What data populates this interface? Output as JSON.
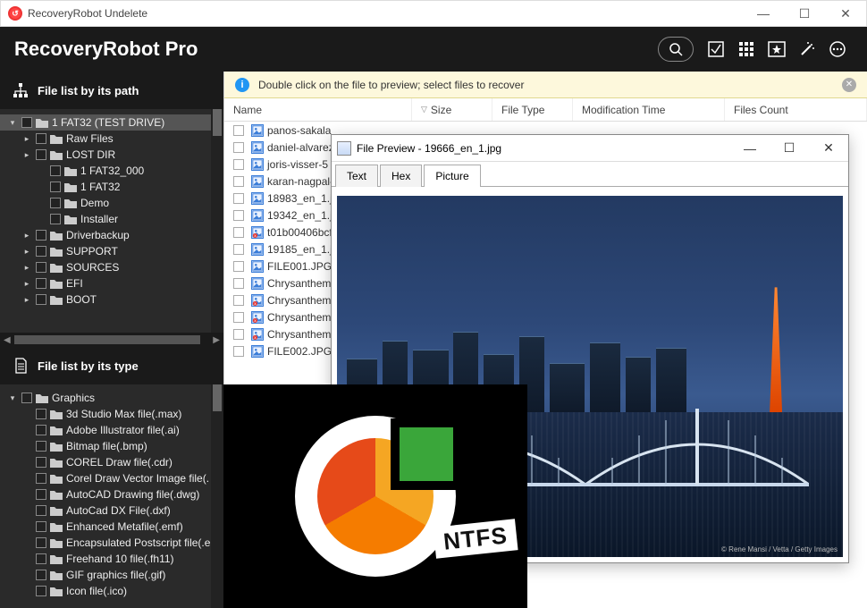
{
  "window": {
    "title": "RecoveryRobot Undelete"
  },
  "brand": "RecoveryRobot Pro",
  "info_bar": {
    "text": "Double click on the file to preview; select files to recover"
  },
  "columns": {
    "name": "Name",
    "size": "Size",
    "file_type": "File Type",
    "mod_time": "Modification Time",
    "files_count": "Files Count"
  },
  "sidebar": {
    "path_header": "File list by its path",
    "type_header": "File list by its type",
    "path_tree": [
      {
        "depth": 0,
        "caret": "▾",
        "label": "1 FAT32 (TEST DRIVE)",
        "selected": true
      },
      {
        "depth": 1,
        "caret": "▸",
        "label": "Raw Files"
      },
      {
        "depth": 1,
        "caret": "▸",
        "label": "LOST DIR"
      },
      {
        "depth": 2,
        "caret": "",
        "label": "1 FAT32_000"
      },
      {
        "depth": 2,
        "caret": "",
        "label": "1 FAT32"
      },
      {
        "depth": 2,
        "caret": "",
        "label": "Demo"
      },
      {
        "depth": 2,
        "caret": "",
        "label": "Installer"
      },
      {
        "depth": 1,
        "caret": "▸",
        "label": "Driverbackup"
      },
      {
        "depth": 1,
        "caret": "▸",
        "label": "SUPPORT"
      },
      {
        "depth": 1,
        "caret": "▸",
        "label": "SOURCES"
      },
      {
        "depth": 1,
        "caret": "▸",
        "label": "EFI"
      },
      {
        "depth": 1,
        "caret": "▸",
        "label": "BOOT"
      }
    ],
    "type_tree": [
      {
        "depth": 0,
        "caret": "▾",
        "label": "Graphics"
      },
      {
        "depth": 1,
        "caret": "",
        "label": "3d Studio Max file(.max)"
      },
      {
        "depth": 1,
        "caret": "",
        "label": "Adobe Illustrator file(.ai)"
      },
      {
        "depth": 1,
        "caret": "",
        "label": "Bitmap file(.bmp)"
      },
      {
        "depth": 1,
        "caret": "",
        "label": "COREL Draw file(.cdr)"
      },
      {
        "depth": 1,
        "caret": "",
        "label": "Corel Draw Vector Image file(."
      },
      {
        "depth": 1,
        "caret": "",
        "label": "AutoCAD Drawing file(.dwg)"
      },
      {
        "depth": 1,
        "caret": "",
        "label": "AutoCad DX File(.dxf)"
      },
      {
        "depth": 1,
        "caret": "",
        "label": "Enhanced Metafile(.emf)"
      },
      {
        "depth": 1,
        "caret": "",
        "label": "Encapsulated Postscript file(.e"
      },
      {
        "depth": 1,
        "caret": "",
        "label": "Freehand 10 file(.fh11)"
      },
      {
        "depth": 1,
        "caret": "",
        "label": "GIF graphics file(.gif)"
      },
      {
        "depth": 1,
        "caret": "",
        "label": "Icon file(.ico)"
      }
    ]
  },
  "files": [
    {
      "name": "panos-sakala",
      "bad": false
    },
    {
      "name": "daniel-alvarez",
      "bad": false
    },
    {
      "name": "joris-visser-5",
      "bad": false
    },
    {
      "name": "karan-nagpal-",
      "bad": false
    },
    {
      "name": "18983_en_1.jp",
      "bad": false
    },
    {
      "name": "19342_en_1.jp",
      "bad": false
    },
    {
      "name": "t01b00406bcf",
      "bad": true
    },
    {
      "name": "19185_en_1.jp",
      "bad": false
    },
    {
      "name": "FILE001.JPG",
      "bad": false
    },
    {
      "name": "Chrysanthemu",
      "bad": false
    },
    {
      "name": "Chrysanthemu",
      "bad": true
    },
    {
      "name": "Chrysanthemu",
      "bad": true
    },
    {
      "name": "Chrysanthemu",
      "bad": true
    },
    {
      "name": "FILE002.JPG",
      "bad": false
    }
  ],
  "preview": {
    "title": "File Preview - 19666_en_1.jpg",
    "tabs": {
      "text": "Text",
      "hex": "Hex",
      "picture": "Picture"
    },
    "credit": "© Rene Mansi / Vetta / Getty Images"
  },
  "promo": {
    "label": "NTFS"
  }
}
